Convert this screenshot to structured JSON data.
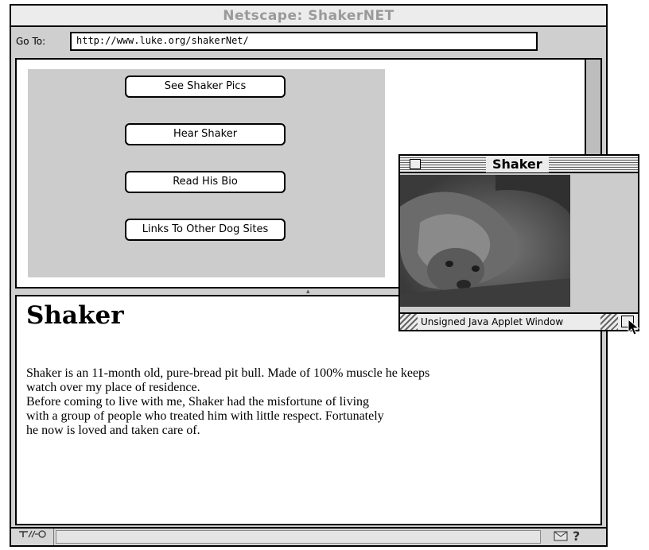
{
  "window": {
    "title": "Netscape: ShakerNET"
  },
  "location": {
    "label": "Go To:",
    "url": "http://www.luke.org/shakerNet/"
  },
  "nav_buttons": [
    {
      "label": "See Shaker Pics"
    },
    {
      "label": "Hear Shaker"
    },
    {
      "label": "Read His Bio"
    },
    {
      "label": "Links To Other Dog Sites"
    }
  ],
  "content": {
    "heading": "Shaker",
    "paragraph_lines": [
      "Shaker is an 11-month old, pure-bread pit bull. Made of 100% muscle he keeps",
      "watch over my place of residence.",
      "Before coming to live with me, Shaker had the misfortune of living",
      "with a group of people who treated him with little respect. Fortunately",
      "he now is loved and taken care of."
    ]
  },
  "applet": {
    "title": "Shaker",
    "warning": "Unsigned Java Applet Window"
  },
  "statusbar": {
    "security_icon": "broken-key-icon",
    "help": "?"
  },
  "colors": {
    "title_text": "#9a9a9a",
    "panel_gray": "#cccccc"
  }
}
